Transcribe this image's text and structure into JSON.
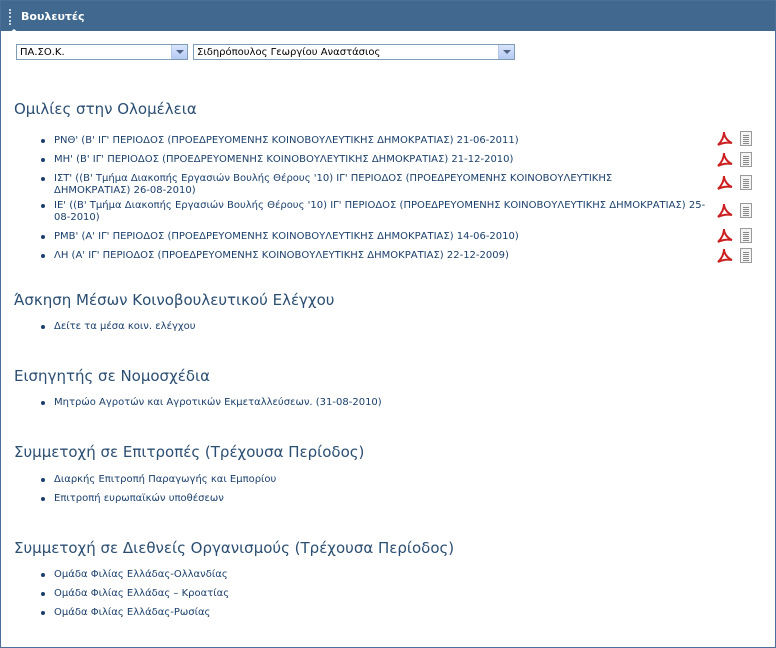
{
  "panel": {
    "title": "Βουλευτές"
  },
  "selects": {
    "party": "ΠΑ.ΣΟ.Κ.",
    "member": "Σιδηρόπουλος Γεωργίου Αναστάσιος"
  },
  "sections": {
    "speeches": {
      "title": "Ομιλίες στην Ολομέλεια",
      "items": [
        "ΡΝΘ' (Β' ΙΓ' ΠΕΡΙΟΔΟΣ (ΠΡΟΕΔΡΕΥΟΜΕΝΗΣ ΚΟΙΝΟΒΟΥΛΕΥΤΙΚΗΣ ΔΗΜΟΚΡΑΤΙΑΣ) 21-06-2011)",
        "ΜΗ' (Β' ΙΓ' ΠΕΡΙΟΔΟΣ (ΠΡΟΕΔΡΕΥΟΜΕΝΗΣ ΚΟΙΝΟΒΟΥΛΕΥΤΙΚΗΣ ΔΗΜΟΚΡΑΤΙΑΣ) 21-12-2010)",
        "ΙΣΤ' ((Β' Τμήμα Διακοπής Εργασιών Βουλής Θέρους '10) ΙΓ' ΠΕΡΙΟΔΟΣ (ΠΡΟΕΔΡΕΥΟΜΕΝΗΣ ΚΟΙΝΟΒΟΥΛΕΥΤΙΚΗΣ ΔΗΜΟΚΡΑΤΙΑΣ) 26-08-2010)",
        "ΙΕ' ((Β' Τμήμα Διακοπής Εργασιών Βουλής Θέρους '10) ΙΓ' ΠΕΡΙΟΔΟΣ (ΠΡΟΕΔΡΕΥΟΜΕΝΗΣ ΚΟΙΝΟΒΟΥΛΕΥΤΙΚΗΣ ΔΗΜΟΚΡΑΤΙΑΣ) 25-08-2010)",
        "ΡΜΒ' (Α' ΙΓ' ΠΕΡΙΟΔΟΣ (ΠΡΟΕΔΡΕΥΟΜΕΝΗΣ ΚΟΙΝΟΒΟΥΛΕΥΤΙΚΗΣ ΔΗΜΟΚΡΑΤΙΑΣ) 14-06-2010)",
        "ΛΗ (Α' ΙΓ' ΠΕΡΙΟΔΟΣ (ΠΡΟΕΔΡΕΥΟΜΕΝΗΣ ΚΟΙΝΟΒΟΥΛΕΥΤΙΚΗΣ ΔΗΜΟΚΡΑΤΙΑΣ) 22-12-2009)"
      ]
    },
    "control": {
      "title": "Άσκηση Μέσων Κοινοβουλευτικού Ελέγχου",
      "items": [
        "Δείτε τα μέσα κοιν. ελέγχου"
      ]
    },
    "rapporteur": {
      "title": "Εισηγητής σε Νομοσχέδια",
      "items": [
        "Μητρώο Αγροτών και Αγροτικών Εκμεταλλεύσεων. (31-08-2010)"
      ]
    },
    "committees": {
      "title": "Συμμετοχή σε Επιτροπές (Τρέχουσα Περίοδος)",
      "items": [
        "Διαρκής Επιτροπή Παραγωγής και Εμπορίου",
        "Επιτροπή ευρωπαϊκών υποθέσεων"
      ]
    },
    "organizations": {
      "title": "Συμμετοχή σε Διεθνείς Οργανισμούς (Τρέχουσα Περίοδος)",
      "items": [
        "Ομάδα Φιλίας Ελλάδας-Ολλανδίας",
        "Ομάδα Φιλίας Ελλάδας – Κροατίας",
        "Ομάδα Φιλίας Ελλάδας-Ρωσίας"
      ]
    }
  },
  "icons": {
    "pdf": "pdf-icon",
    "document": "document-icon"
  },
  "colors": {
    "header": "#41698f",
    "heading": "#2b4e72",
    "link": "#1a3f6b",
    "pdf_red": "#cc1f1f"
  }
}
